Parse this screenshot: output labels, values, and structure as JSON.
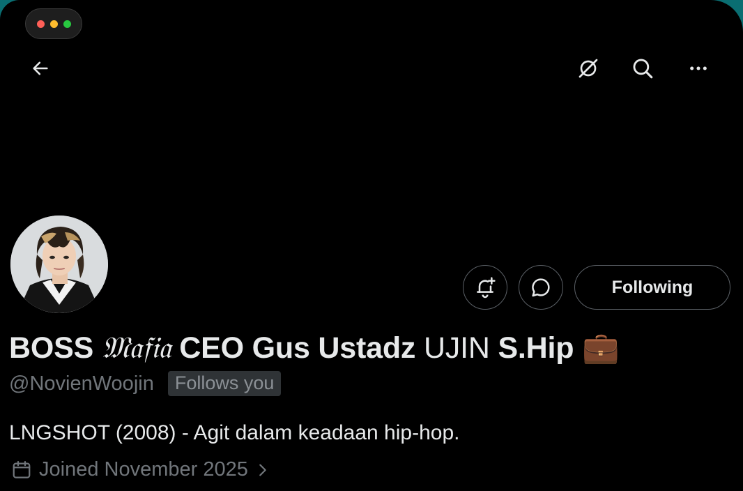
{
  "window": {
    "controls": [
      {
        "name": "close",
        "color": "#ff5f57"
      },
      {
        "name": "minimize",
        "color": "#febc2e"
      },
      {
        "name": "zoom",
        "color": "#28c840"
      }
    ]
  },
  "header": {
    "back_icon": "arrow-left-icon",
    "actions": [
      "grok-icon",
      "search-icon",
      "more-icon"
    ]
  },
  "profile": {
    "display_name_parts": {
      "a": "BOSS ",
      "b": "𝔐𝔞𝔣𝔦𝔞",
      "c": " CEO Gus Ustadz ",
      "d": "UJIN",
      "e": " S.Hip ",
      "emoji": "💼"
    },
    "handle": "@NovienWoojin",
    "follows_you": "Follows you",
    "bio": "LNGSHOT (2008) - Agit dalam keadaan hip-hop.",
    "joined": "Joined November 2025",
    "following_label": "Following"
  },
  "colors": {
    "background": "#000000",
    "text_primary": "#e7e9ea",
    "text_secondary": "#71767b",
    "border": "#5b6066"
  }
}
